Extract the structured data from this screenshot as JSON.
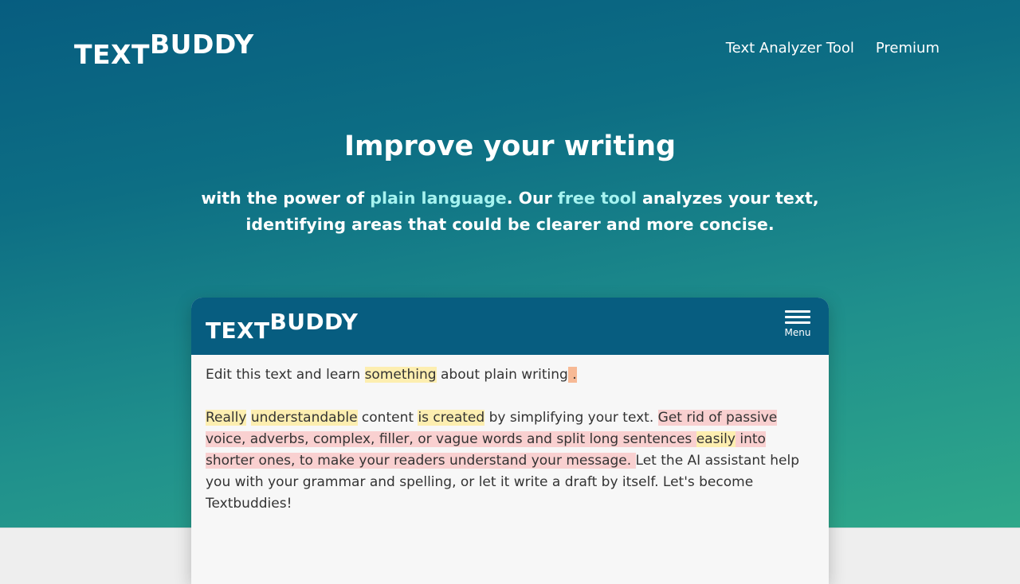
{
  "brand": {
    "logo_part1": "TEXT",
    "logo_part2": "BUDDY"
  },
  "nav": {
    "items": [
      {
        "label": "Text Analyzer Tool"
      },
      {
        "label": "Premium"
      }
    ]
  },
  "hero": {
    "headline": "Improve your writing",
    "sub_1": "with the power of ",
    "sub_hl1": "plain language",
    "sub_2": ". Our ",
    "sub_hl2": "free tool",
    "sub_3": " analyzes your text, identifying areas that could be clearer and more concise."
  },
  "app": {
    "logo_part1": "TEXT",
    "logo_part2": "BUDDY",
    "menu_label": "Menu"
  },
  "editor": {
    "p1": [
      {
        "text": "Edit this text and learn ",
        "mark": ""
      },
      {
        "text": "something",
        "mark": "y"
      },
      {
        "text": " about plain writing",
        "mark": ""
      },
      {
        "text": " .",
        "mark": "o"
      }
    ],
    "p2": [
      {
        "text": "Really",
        "mark": "y"
      },
      {
        "text": " ",
        "mark": ""
      },
      {
        "text": "understandable",
        "mark": "y"
      },
      {
        "text": " content ",
        "mark": ""
      },
      {
        "text": "is created",
        "mark": "y"
      },
      {
        "text": " by simplifying your text. ",
        "mark": ""
      },
      {
        "text": "Get rid of passive voice, adverbs, complex, filler, or vague words and split long sentences ",
        "mark": "r"
      },
      {
        "text": "easily",
        "mark": "y"
      },
      {
        "text": " into shorter ones, to make your readers understand your message. ",
        "mark": "r"
      },
      {
        "text": "Let the AI assistant help you with your grammar and spelling, or let it write a draft by itself. Let's become Textbuddies!",
        "mark": ""
      }
    ]
  },
  "colors": {
    "brand_blue": "#075d80",
    "brand_teal": "#2fa88a",
    "highlight_link": "#a6f3f0",
    "mark_yellow": "#fdeeb0",
    "mark_red": "#f9d0d0",
    "mark_orange": "#f7b995"
  }
}
